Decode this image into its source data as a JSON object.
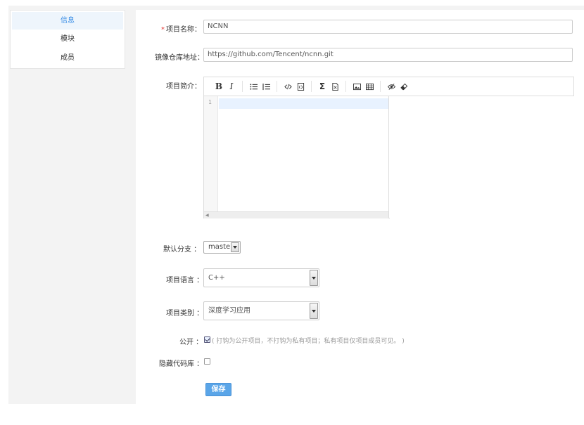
{
  "sidebar": {
    "items": [
      {
        "label": "信息",
        "active": true
      },
      {
        "label": "模块",
        "active": false
      },
      {
        "label": "成员",
        "active": false
      }
    ]
  },
  "form": {
    "required_mark": "*",
    "project_name": {
      "label": "项目名称：",
      "value": "NCNN"
    },
    "mirror_repo": {
      "label": "镜像仓库地址：",
      "value": "https://github.com/Tencent/ncnn.git"
    },
    "intro": {
      "label": "项目简介：",
      "line_number": "1",
      "toolbar": {
        "bold": "B",
        "italic": "I",
        "sigma": "Σ"
      }
    },
    "default_branch": {
      "label": "默认分支 ：",
      "value": "master"
    },
    "language": {
      "label": "项目语言 ：",
      "value": "C++"
    },
    "category": {
      "label": "项目类别 ：",
      "value": "深度学习应用"
    },
    "public": {
      "label": "公开 ：",
      "checked": true,
      "hint": "( 打钩为公开项目，不打钩为私有项目；私有项目仅项目成员可见。 )"
    },
    "hide_repo": {
      "label": "隐藏代码库 ：",
      "checked": false
    },
    "save_label": "保存"
  },
  "colors": {
    "accent": "#3a8ee6",
    "save_button": "#5aa5e8",
    "required": "#e53935"
  }
}
